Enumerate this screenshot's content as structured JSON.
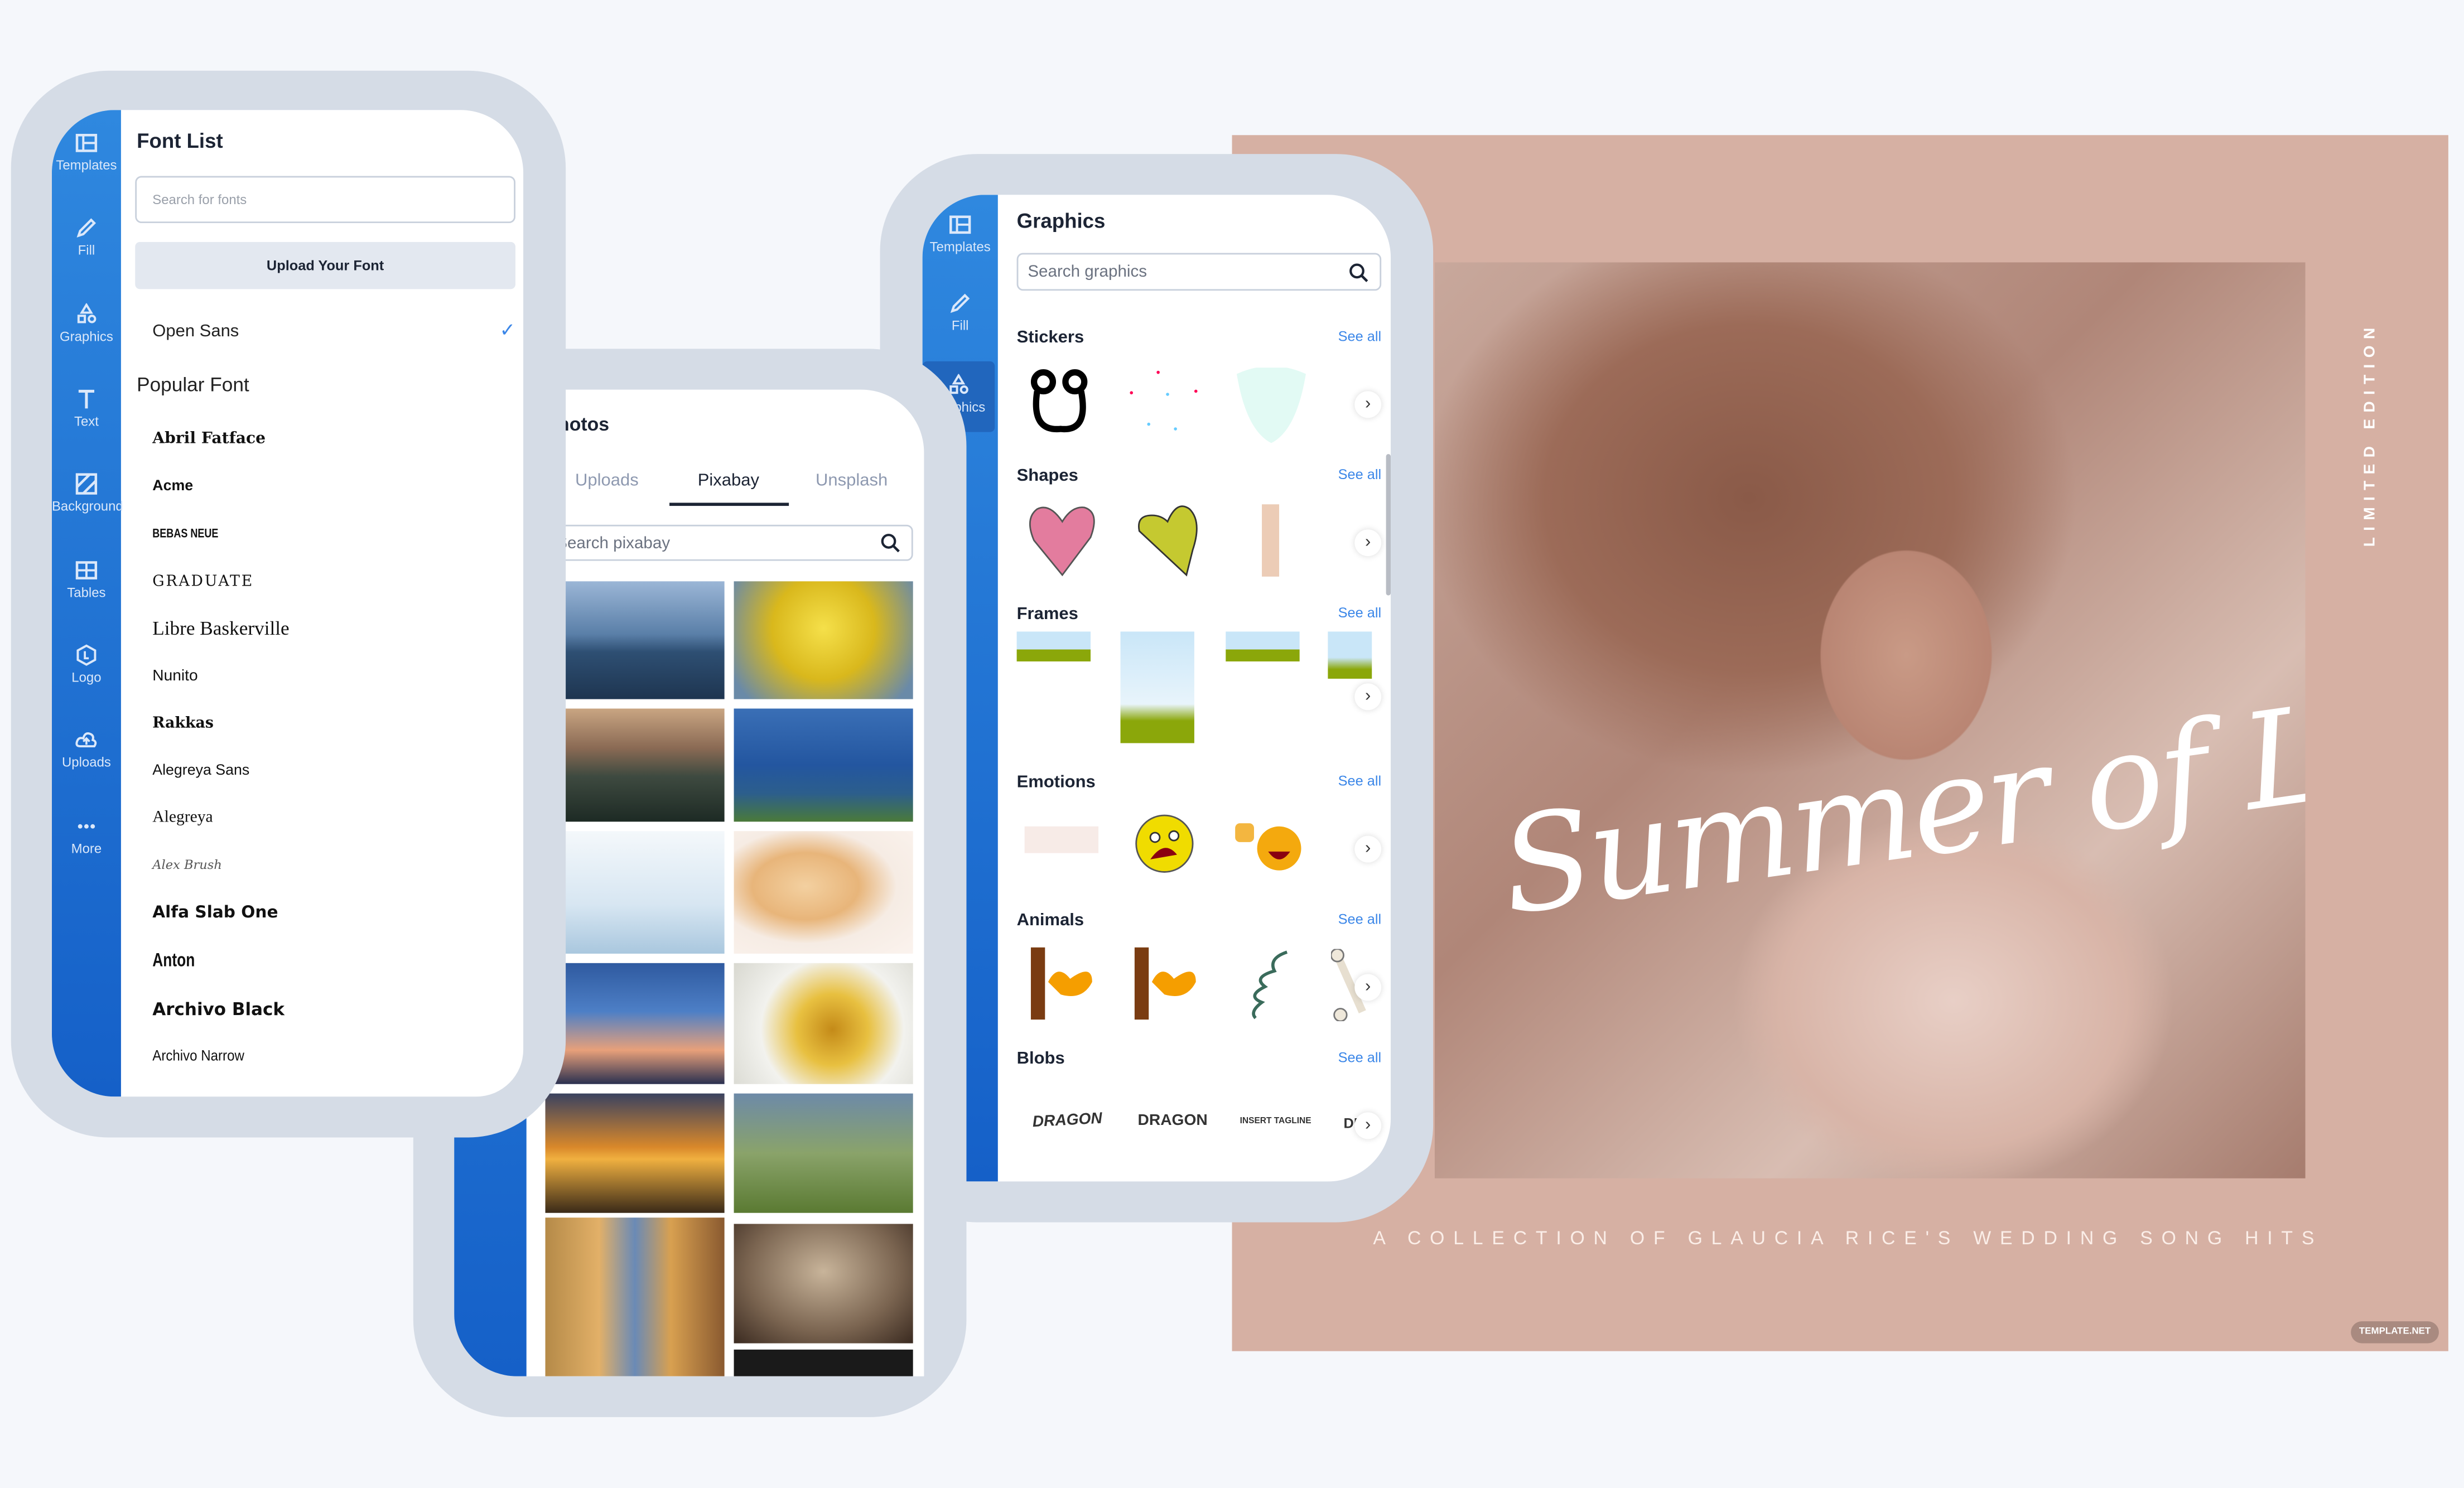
{
  "colors": {
    "background": "#f5f7fb",
    "frame": "#d5dce6",
    "sidebar_top": "#2f88df",
    "sidebar_bottom": "#1560c8",
    "accent_link": "#3a86e8",
    "poster_bg": "#d6b0a3"
  },
  "font_panel": {
    "title": "Font List",
    "search_placeholder": "Search for fonts",
    "upload_button": "Upload Your Font",
    "selected_font": "Open Sans",
    "popular_heading": "Popular Font",
    "fonts": [
      "Abril Fatface",
      "Acme",
      "BEBAS NEUE",
      "GRADUATE",
      "Libre Baskerville",
      "Nunito",
      "Rakkas",
      "Alegreya Sans",
      "Alegreya",
      "Alex Brush",
      "Alfa Slab One",
      "Anton",
      "Archivo Black",
      "Archivo Narrow"
    ],
    "sidebar": [
      {
        "label": "Templates",
        "icon": "templates-icon"
      },
      {
        "label": "Fill",
        "icon": "pencil-icon"
      },
      {
        "label": "Graphics",
        "icon": "shapes-icon"
      },
      {
        "label": "Text",
        "icon": "text-icon"
      },
      {
        "label": "Background",
        "icon": "background-icon"
      },
      {
        "label": "Tables",
        "icon": "table-icon"
      },
      {
        "label": "Logo",
        "icon": "logo-icon"
      },
      {
        "label": "Uploads",
        "icon": "cloud-upload-icon"
      },
      {
        "label": "More",
        "icon": "more-icon"
      }
    ]
  },
  "photos_panel": {
    "title": "Photos",
    "tabs": [
      {
        "label": "Uploads",
        "active": false
      },
      {
        "label": "Pixabay",
        "active": true
      },
      {
        "label": "Unsplash",
        "active": false
      }
    ],
    "search_placeholder": "Search pixabay"
  },
  "graphics_panel": {
    "title": "Graphics",
    "search_placeholder": "Search graphics",
    "see_all": "See all",
    "sidebar": [
      {
        "label": "Templates",
        "icon": "templates-icon"
      },
      {
        "label": "Fill",
        "icon": "pencil-icon"
      },
      {
        "label": "Graphics",
        "icon": "shapes-icon"
      }
    ],
    "sections": [
      "Stickers",
      "Shapes",
      "Frames",
      "Emotions",
      "Animals",
      "Blobs"
    ],
    "blob_texts": [
      "DRAGON",
      "DRAGON",
      "INSERT TAGLINE",
      "DRA"
    ]
  },
  "poster": {
    "script_title": "Summer of Love",
    "side_text": "LIMITED EDITION",
    "subtitle": "A COLLECTION OF GLAUCIA RICE'S WEDDING SONG HITS",
    "badge": "TEMPLATE.NET"
  }
}
